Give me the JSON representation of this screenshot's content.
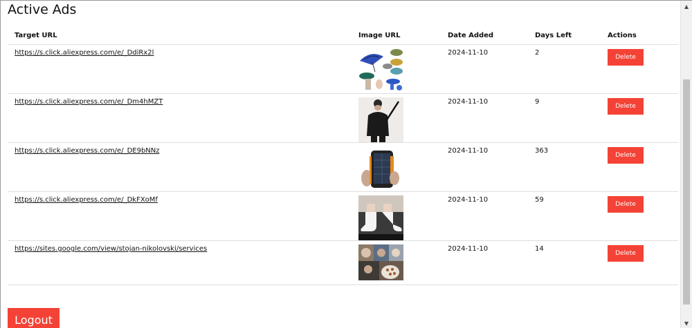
{
  "page": {
    "title": "Active Ads",
    "logout_label": "Logout"
  },
  "table": {
    "headers": {
      "target_url": "Target URL",
      "image_url": "Image URL",
      "date_added": "Date Added",
      "days_left": "Days Left",
      "actions": "Actions"
    },
    "delete_label": "Delete",
    "rows": [
      {
        "target_url": "https://s.click.aliexpress.com/e/_DdiRx2l",
        "image": "umbrella-hat-product-image",
        "date_added": "2024-11-10",
        "days_left": "2"
      },
      {
        "target_url": "https://s.click.aliexpress.com/e/_Dm4hMZT",
        "image": "person-with-umbrella-product-image",
        "date_added": "2024-11-10",
        "days_left": "9"
      },
      {
        "target_url": "https://s.click.aliexpress.com/e/_DE9bNNz",
        "image": "solar-power-bank-product-image",
        "date_added": "2024-11-10",
        "days_left": "363"
      },
      {
        "target_url": "https://s.click.aliexpress.com/e/_DkFXoMf",
        "image": "white-socks-product-image",
        "date_added": "2024-11-10",
        "days_left": "59"
      },
      {
        "target_url": "https://sites.google.com/view/stojan-nikolovski/services",
        "image": "collage-image",
        "date_added": "2024-11-10",
        "days_left": "14"
      }
    ]
  },
  "colors": {
    "danger": "#f44336",
    "divider": "#dedede"
  }
}
